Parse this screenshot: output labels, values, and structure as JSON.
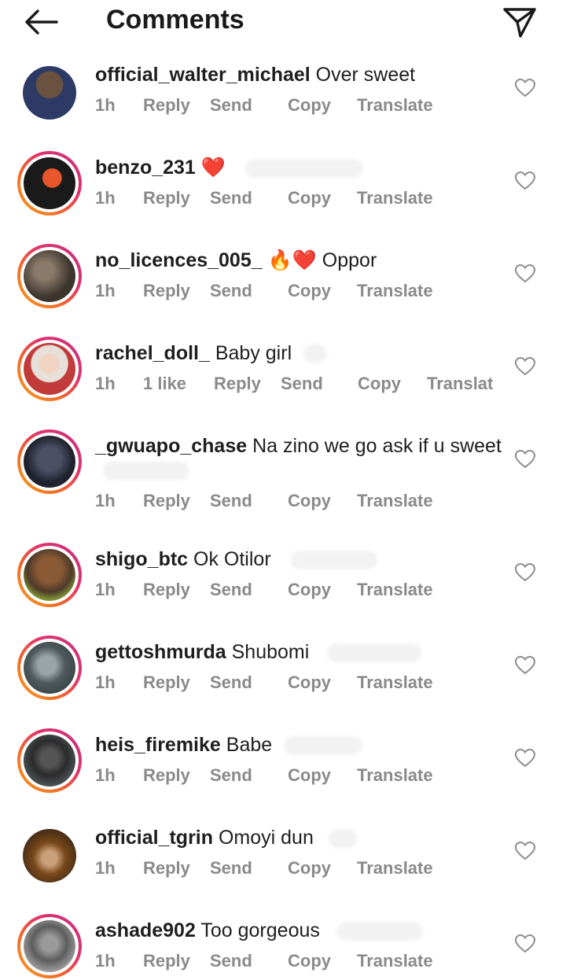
{
  "header": {
    "title": "Comments",
    "back_icon": "arrow-left-icon",
    "send_icon": "paper-plane-icon"
  },
  "actions": {
    "time": "1h",
    "reply": "Reply",
    "send": "Send",
    "copy": "Copy",
    "translate": "Translate"
  },
  "comments": [
    {
      "username": "official_walter_michael",
      "text": " Over sweet",
      "time": "1h",
      "ring": false,
      "avatar_color": "#2d3a66"
    },
    {
      "username": "benzo_231",
      "text": " ❤️",
      "time": "1h",
      "ring": true,
      "avatar_color": "#1a1a1a"
    },
    {
      "username": "no_licences_005_",
      "text": " 🔥❤️ Oppor",
      "time": "1h",
      "ring": true,
      "avatar_color": "#5a5046"
    },
    {
      "username": "rachel_doll_",
      "text": " Baby girl",
      "time": "1h",
      "likes": "1 like",
      "translate": "Translat",
      "ring": true,
      "avatar_color": "#c23b3b"
    },
    {
      "username": "_gwuapo_chase",
      "text": " Na zino we go ask if u sweet",
      "time": "1h",
      "ring": true,
      "avatar_color": "#2e3344"
    },
    {
      "username": "shigo_btc",
      "text": " Ok Otilor",
      "time": "1h",
      "ring": true,
      "avatar_color": "#6b4a2e"
    },
    {
      "username": "gettoshmurda",
      "text": " Shubomi",
      "time": "1h",
      "ring": true,
      "avatar_color": "#4e5a5e"
    },
    {
      "username": "heis_firemike",
      "text": " Babe",
      "time": "1h",
      "ring": true,
      "avatar_color": "#2b2b2b"
    },
    {
      "username": "official_tgrin",
      "text": " Omoyi dun",
      "time": "1h",
      "ring": false,
      "avatar_color": "#7a4a1c"
    },
    {
      "username": "ashade902",
      "text": " Too gorgeous",
      "time": "1h",
      "ring": true,
      "avatar_color": "#5d5d5d"
    }
  ],
  "colors": {
    "meta": "#8a8a8a",
    "text": "#1e1e1e",
    "ring_start": "#f9a11f",
    "ring_end": "#c13584"
  }
}
